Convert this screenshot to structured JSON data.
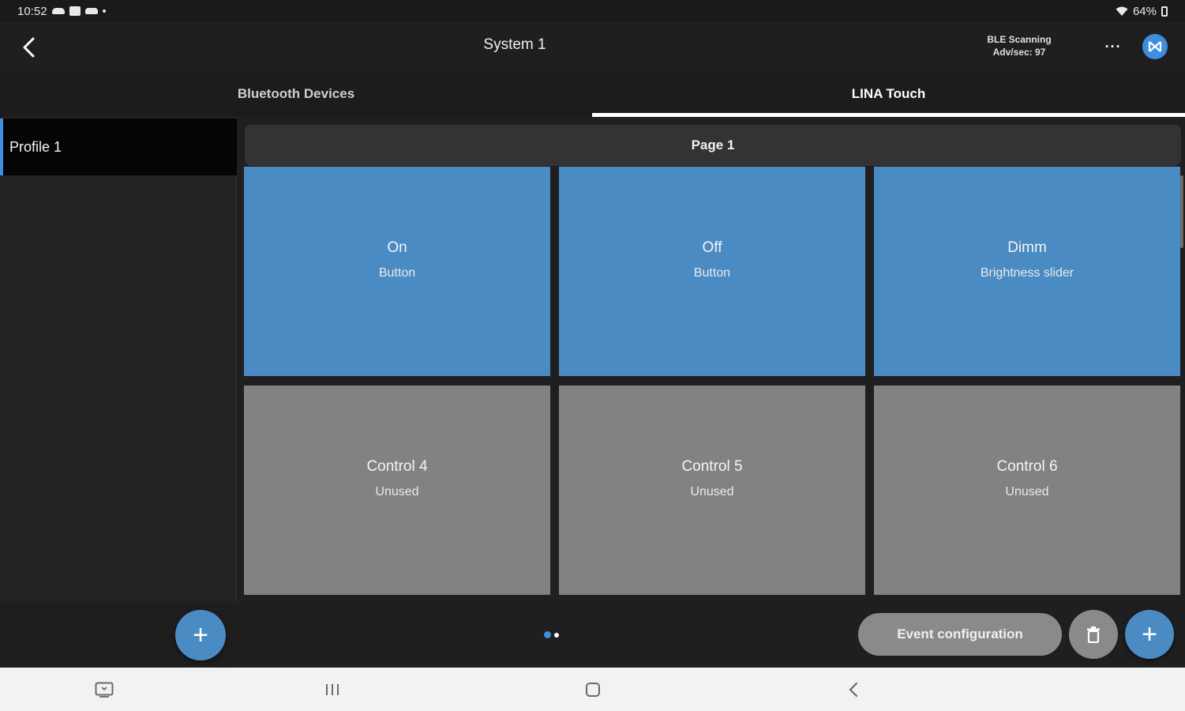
{
  "status_bar": {
    "time": "10:52",
    "battery": "64%"
  },
  "app_bar": {
    "title": "System 1",
    "ble_line1": "BLE Scanning",
    "ble_line2": "Adv/sec: 97",
    "more_label": "···"
  },
  "tabs": [
    {
      "label": "Bluetooth Devices",
      "active": false
    },
    {
      "label": "LINA Touch",
      "active": true
    }
  ],
  "profiles": [
    {
      "label": "Profile 1",
      "selected": true
    }
  ],
  "page": {
    "title": "Page 1",
    "current_index": 1,
    "total_pages": 2
  },
  "controls": [
    {
      "name": "On",
      "type": "Button",
      "used": true
    },
    {
      "name": "Off",
      "type": "Button",
      "used": true
    },
    {
      "name": "Dimm",
      "type": "Brightness slider",
      "used": true
    },
    {
      "name": "Control 4",
      "type": "Unused",
      "used": false
    },
    {
      "name": "Control 5",
      "type": "Unused",
      "used": false
    },
    {
      "name": "Control 6",
      "type": "Unused",
      "used": false
    }
  ],
  "actions": {
    "event_config_label": "Event configuration",
    "add_symbol": "+"
  },
  "colors": {
    "accent": "#4a8bc4",
    "unused_tile": "#828282",
    "bluetooth_blue": "#3d8ede"
  },
  "icons": {
    "back": "arrow-left-icon",
    "more": "more-horizontal-icon",
    "ble": "bluetooth-icon",
    "delete": "trash-icon",
    "nav": [
      "screenshot-icon",
      "recents-icon",
      "home-icon",
      "back-chevron-icon"
    ]
  }
}
